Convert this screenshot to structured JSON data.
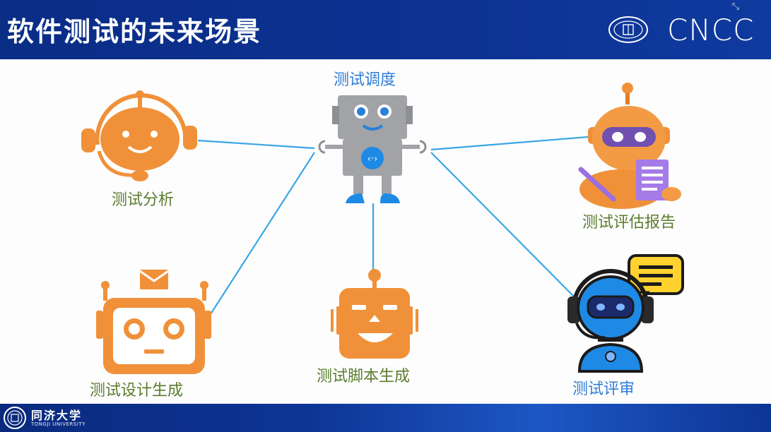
{
  "slide": {
    "title": "软件测试的未来场景",
    "brand": "CNCC",
    "footer_org": "同济大学",
    "footer_org_en": "TONGJI UNIVERSITY"
  },
  "diagram": {
    "center": {
      "label": "测试调度"
    },
    "nodes": [
      {
        "id": "analysis",
        "label": "测试分析"
      },
      {
        "id": "design",
        "label": "测试设计生成"
      },
      {
        "id": "script",
        "label": "测试脚本生成"
      },
      {
        "id": "report",
        "label": "测试评估报告"
      },
      {
        "id": "review",
        "label": "测试评审"
      }
    ],
    "edges": [
      [
        "center",
        "analysis"
      ],
      [
        "center",
        "design"
      ],
      [
        "center",
        "script"
      ],
      [
        "center",
        "report"
      ],
      [
        "center",
        "review"
      ]
    ]
  },
  "colors": {
    "header_bg": "#0c3292",
    "label_green": "#5a7d2e",
    "label_blue": "#2f7ed6",
    "connector": "#39a6e6",
    "robot_orange": "#f0913a",
    "robot_gray": "#9ea0a3",
    "robot_blue": "#1e8ae6"
  },
  "icons": {
    "center": "gray-robot-icon",
    "analysis": "headset-robot-icon",
    "design": "mail-robot-icon",
    "script": "square-robot-icon",
    "report": "robot-with-document-icon",
    "review": "support-robot-with-speech-bubble-icon"
  }
}
